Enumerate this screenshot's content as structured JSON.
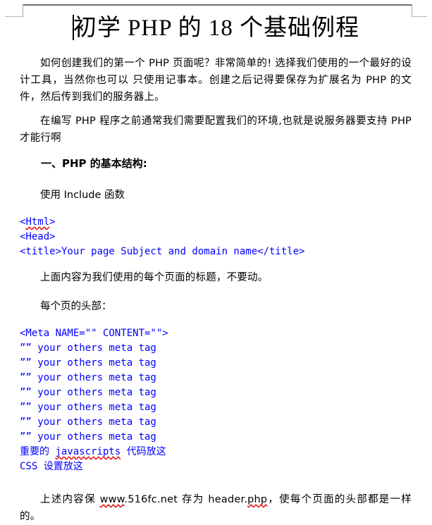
{
  "document": {
    "title": "初学 PHP 的 18 个基础例程",
    "caret_visible": true,
    "paragraphs": {
      "intro": "如何创建我们的第一个 PHP 页面呢？非常简单的! 选择我们使用的一个最好的设计工具，当然你也可以 只使用记事本。创建之后记得要保存为扩展名为 PHP 的文件，然后传到我们的服务器上。",
      "env": "在编写 PHP 程序之前通常我们需要配置我们的环境,也就是说服务器要支持 PHP 才能行啊",
      "title_note": "上面内容为我们使用的每个页面的标题，不要动。",
      "header_note_prefix": "上述内容保 ",
      "header_note_url": "www",
      "header_note_mid": ".516fc.net 存为 header.",
      "header_note_ext": "php",
      "header_note_suffix": "，使每个页面的头部都是一样的。"
    },
    "headings": {
      "section_one": "一、PHP 的基本结构:"
    },
    "lines": {
      "use_include": "使用 Include 函数",
      "page_head": "每个页的头部："
    },
    "code_block_1": {
      "line_html_open": "<Html>",
      "line_html_word": "Html",
      "line_head": "<Head>",
      "line_title": "<title>Your page Subject and domain name</title>"
    },
    "code_block_2": {
      "line_meta": "<Meta NAME=\"\" CONTENT=\"\">",
      "meta_repeat_line": "”” your others meta tag",
      "meta_repeat_count": 7,
      "line_js_prefix": "重要的 ",
      "line_js_word": "javascripts",
      "line_js_suffix": " 代码放这",
      "line_css": "CSS 设置放这"
    },
    "colors": {
      "code_blue": "#0000ff",
      "spellcheck_red": "#e00000",
      "mark_dark": "#6f6f6f",
      "mark_light": "#b4b4b4",
      "text_black": "#000000"
    }
  }
}
